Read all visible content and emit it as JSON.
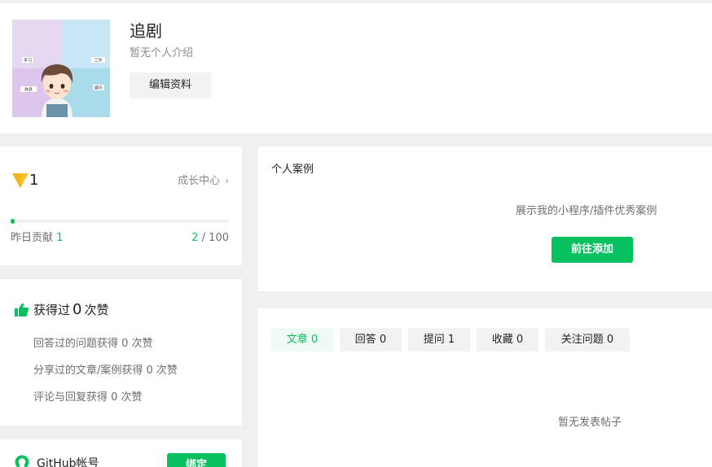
{
  "profile": {
    "username": "追剧",
    "bio": "暂无个人介绍",
    "edit_label": "编辑资料",
    "avatar_labels": [
      "学习",
      "工作",
      "休息",
      "娱乐"
    ]
  },
  "growth": {
    "level": "1",
    "link_label": "成长中心",
    "chevron": "›",
    "progress_fraction": 0.02,
    "yesterday_label": "昨日贡献",
    "yesterday_value": "1",
    "current": "2",
    "total_text": "/ 100"
  },
  "likes": {
    "title_prefix": "获得过",
    "count": "0",
    "title_suffix": "次赞",
    "lines": [
      "回答过的问题获得 0 次赞",
      "分享过的文章/案例获得 0 次赞",
      "评论与回复获得 0 次赞"
    ]
  },
  "github": {
    "label": "GitHub帐号",
    "bind_label": "绑定"
  },
  "cases": {
    "title": "个人案例",
    "description": "展示我的小程序/插件优秀案例",
    "button_label": "前往添加"
  },
  "posts": {
    "tabs": [
      {
        "label": "文章 0",
        "active": true
      },
      {
        "label": "回答 0",
        "active": false
      },
      {
        "label": "提问 1",
        "active": false
      },
      {
        "label": "收藏 0",
        "active": false
      },
      {
        "label": "关注问题 0",
        "active": false
      }
    ],
    "empty_text": "暂无发表帖子"
  },
  "colors": {
    "accent": "#07c160",
    "level_badge": "#f6c12e",
    "background": "#f0f0f0"
  },
  "icons": [
    "level-badge-icon",
    "thumbs-up-icon",
    "github-icon",
    "chevron-right-icon"
  ]
}
